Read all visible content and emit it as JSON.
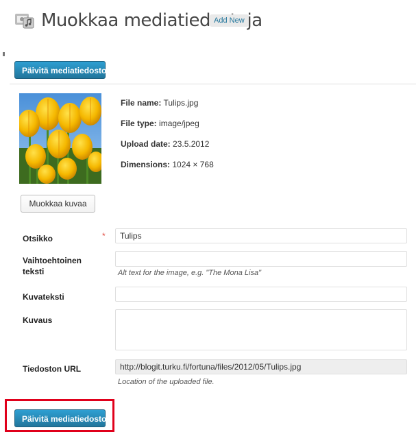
{
  "header": {
    "title": "Muokkaa mediatiedostoja",
    "add_new": "Add New",
    "icon": "media-library-icon"
  },
  "buttons": {
    "update_top": "Päivitä mediatiedosto",
    "update_bottom": "Päivitä mediatiedosto",
    "edit_image": "Muokkaa kuvaa"
  },
  "file_meta": {
    "name_label": "File name:",
    "name_value": "Tulips.jpg",
    "type_label": "File type:",
    "type_value": "image/jpeg",
    "date_label": "Upload date:",
    "date_value": "23.5.2012",
    "dims_label": "Dimensions:",
    "dims_value": "1024 × 768"
  },
  "form": {
    "title_label": "Otsikko",
    "title_required": "*",
    "title_value": "Tulips",
    "alt_label": "Vaihtoehtoinen teksti",
    "alt_value": "",
    "alt_help": "Alt text for the image, e.g. \"The Mona Lisa\"",
    "caption_label": "Kuvateksti",
    "caption_value": "",
    "description_label": "Kuvaus",
    "description_value": "",
    "url_label": "Tiedoston URL",
    "url_value": "http://blogit.turku.fi/fortuna/files/2012/05/Tulips.jpg",
    "url_help": "Location of the uploaded file."
  },
  "colors": {
    "primary_button": "#21759b",
    "highlight_box": "#e0001b",
    "required": "#e14d43"
  }
}
